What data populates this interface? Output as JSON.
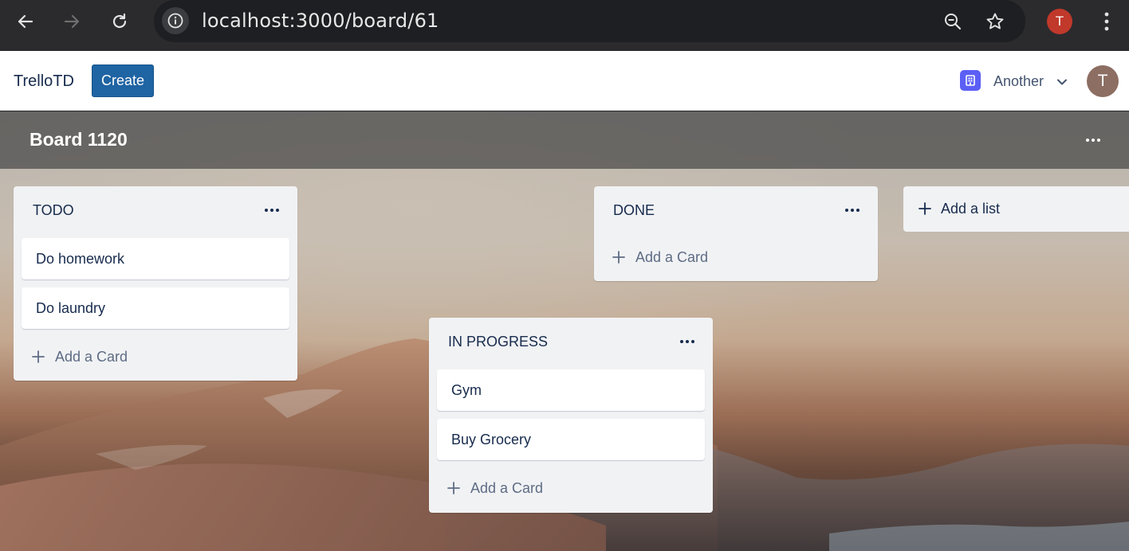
{
  "browser": {
    "url": "localhost:3000/board/61",
    "profile_initial": "T"
  },
  "app": {
    "brand": "TrelloTD",
    "create_label": "Create",
    "workspace_name": "Another",
    "user_initial": "T"
  },
  "board": {
    "title": "Board 1120"
  },
  "lists": [
    {
      "title": "TODO",
      "cards": [
        "Do homework",
        "Do laundry"
      ],
      "add_card_label": "Add a Card"
    },
    {
      "title": "IN PROGRESS",
      "cards": [
        "Gym",
        "Buy Grocery"
      ],
      "add_card_label": "Add a Card"
    },
    {
      "title": "DONE",
      "cards": [],
      "add_card_label": "Add a Card"
    }
  ],
  "add_list_label": "Add a list"
}
